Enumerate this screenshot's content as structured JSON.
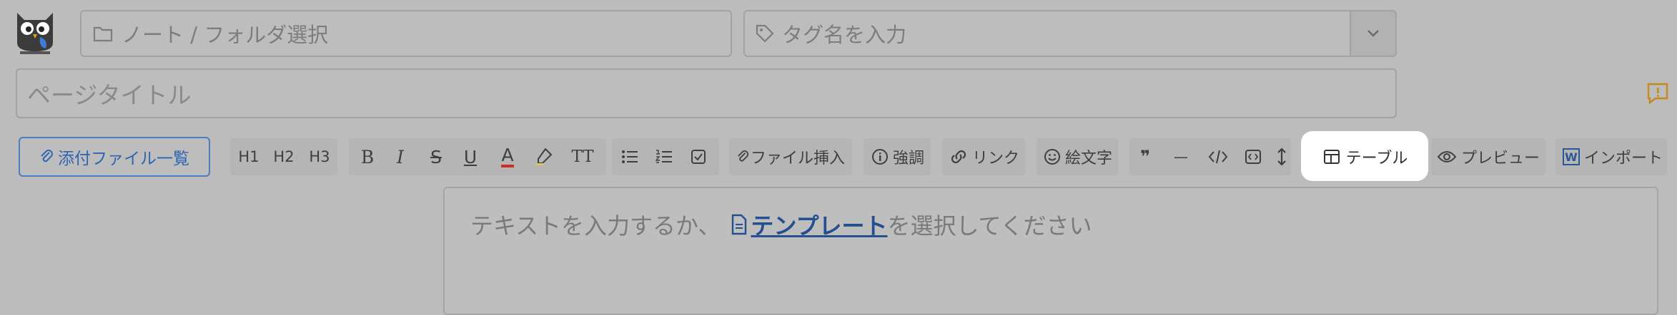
{
  "header": {
    "folder_placeholder": "ノート / フォルダ選択",
    "tag_placeholder": "タグ名を入力",
    "title_placeholder": "ページタイトル"
  },
  "toolbar": {
    "attachments_label": "添付ファイル一覧",
    "h1": "H1",
    "h2": "H2",
    "h3": "H3",
    "bold": "B",
    "italic": "I",
    "strike": "S",
    "underline": "U",
    "font_color": "A",
    "text_size": "TT",
    "insert_file_label": "ファイル挿入",
    "emphasis_label": "強調",
    "link_label": "リンク",
    "emoji_label": "絵文字",
    "quote": "❞",
    "hr": "—",
    "table_label": "テーブル",
    "preview_label": "プレビュー",
    "import_label": "インポート",
    "import_icon_letter": "W"
  },
  "editor": {
    "placeholder_prefix": "テキストを入力するか、",
    "template_link": "テンプレート",
    "placeholder_suffix": "を選択してください"
  },
  "colors": {
    "background": "#bcbcbc",
    "accent": "#2f64b2",
    "font_color_underline": "#c9302c",
    "highlight": "#ffffff",
    "notice": "#c58a1d"
  }
}
